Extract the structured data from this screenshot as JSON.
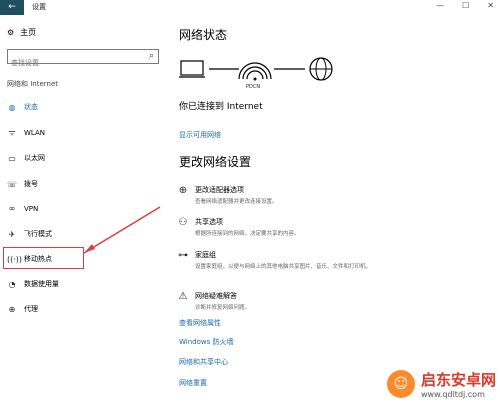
{
  "window": {
    "title": "设置",
    "back": "←",
    "controls": [
      "—",
      "☐",
      "✕"
    ]
  },
  "sidebar": {
    "home": "主页",
    "search_placeholder": "查找设置",
    "section": "网络和 Internet",
    "items": [
      {
        "label": "状态",
        "icon": "globe-icon"
      },
      {
        "label": "WLAN",
        "icon": "wifi-icon"
      },
      {
        "label": "以太网",
        "icon": "ethernet-icon"
      },
      {
        "label": "拨号",
        "icon": "phone-icon"
      },
      {
        "label": "VPN",
        "icon": "vpn-icon"
      },
      {
        "label": "飞行模式",
        "icon": "airplane-icon"
      },
      {
        "label": "移动热点",
        "icon": "hotspot-icon"
      },
      {
        "label": "数据使用量",
        "icon": "data-icon"
      },
      {
        "label": "代理",
        "icon": "proxy-icon"
      }
    ]
  },
  "main": {
    "status_title": "网络状态",
    "network_name": "PDCN",
    "connected": "你已连接到 Internet",
    "show_networks": "显示可用网络",
    "change_title": "更改网络设置",
    "options": [
      {
        "title": "更改适配器选项",
        "desc": "查看网络适配器并更改连接设置。"
      },
      {
        "title": "共享选项",
        "desc": "根据所连接到的网络，决定要共享的内容。"
      },
      {
        "title": "家庭组",
        "desc": "设置家庭组，以便与网络上的其他电脑共享图片、音乐、文件和打印机。"
      },
      {
        "title": "网络疑难解答",
        "desc": "诊断并修复网络问题。"
      }
    ],
    "links": [
      "查看网络属性",
      "Windows 防火墙",
      "网络和共享中心",
      "网络重置"
    ]
  },
  "watermark": {
    "title": "启东安卓网",
    "url": "www.qdltdj.com"
  },
  "colors": {
    "accent": "#1a6aa9",
    "highlight": "#e23b3b",
    "titlebar_back": "#1f4e5f"
  }
}
